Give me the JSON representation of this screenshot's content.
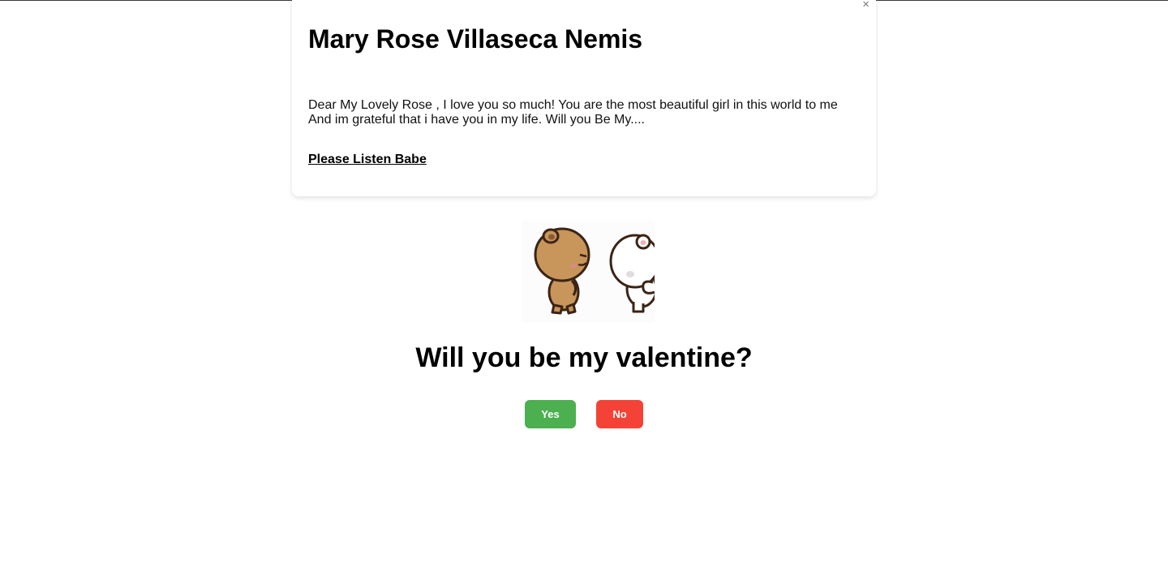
{
  "card": {
    "close_glyph": "×",
    "title": "Mary Rose Villaseca Nemis",
    "message_line1": "Dear My Lovely Rose , I love you so much! You are the most beautiful girl in this world to me",
    "message_line2": "And im grateful that i have you in my life. Will you Be My....",
    "listen_link": "Please Listen Babe"
  },
  "main": {
    "image_icon": "bear-couple-icon",
    "question": "Will you be my valentine?",
    "yes_label": "Yes",
    "no_label": "No"
  },
  "colors": {
    "yes_button": "#4caf50",
    "no_button": "#f44336",
    "brown_bear": "#c8955a",
    "white_bear": "#ffffff"
  }
}
